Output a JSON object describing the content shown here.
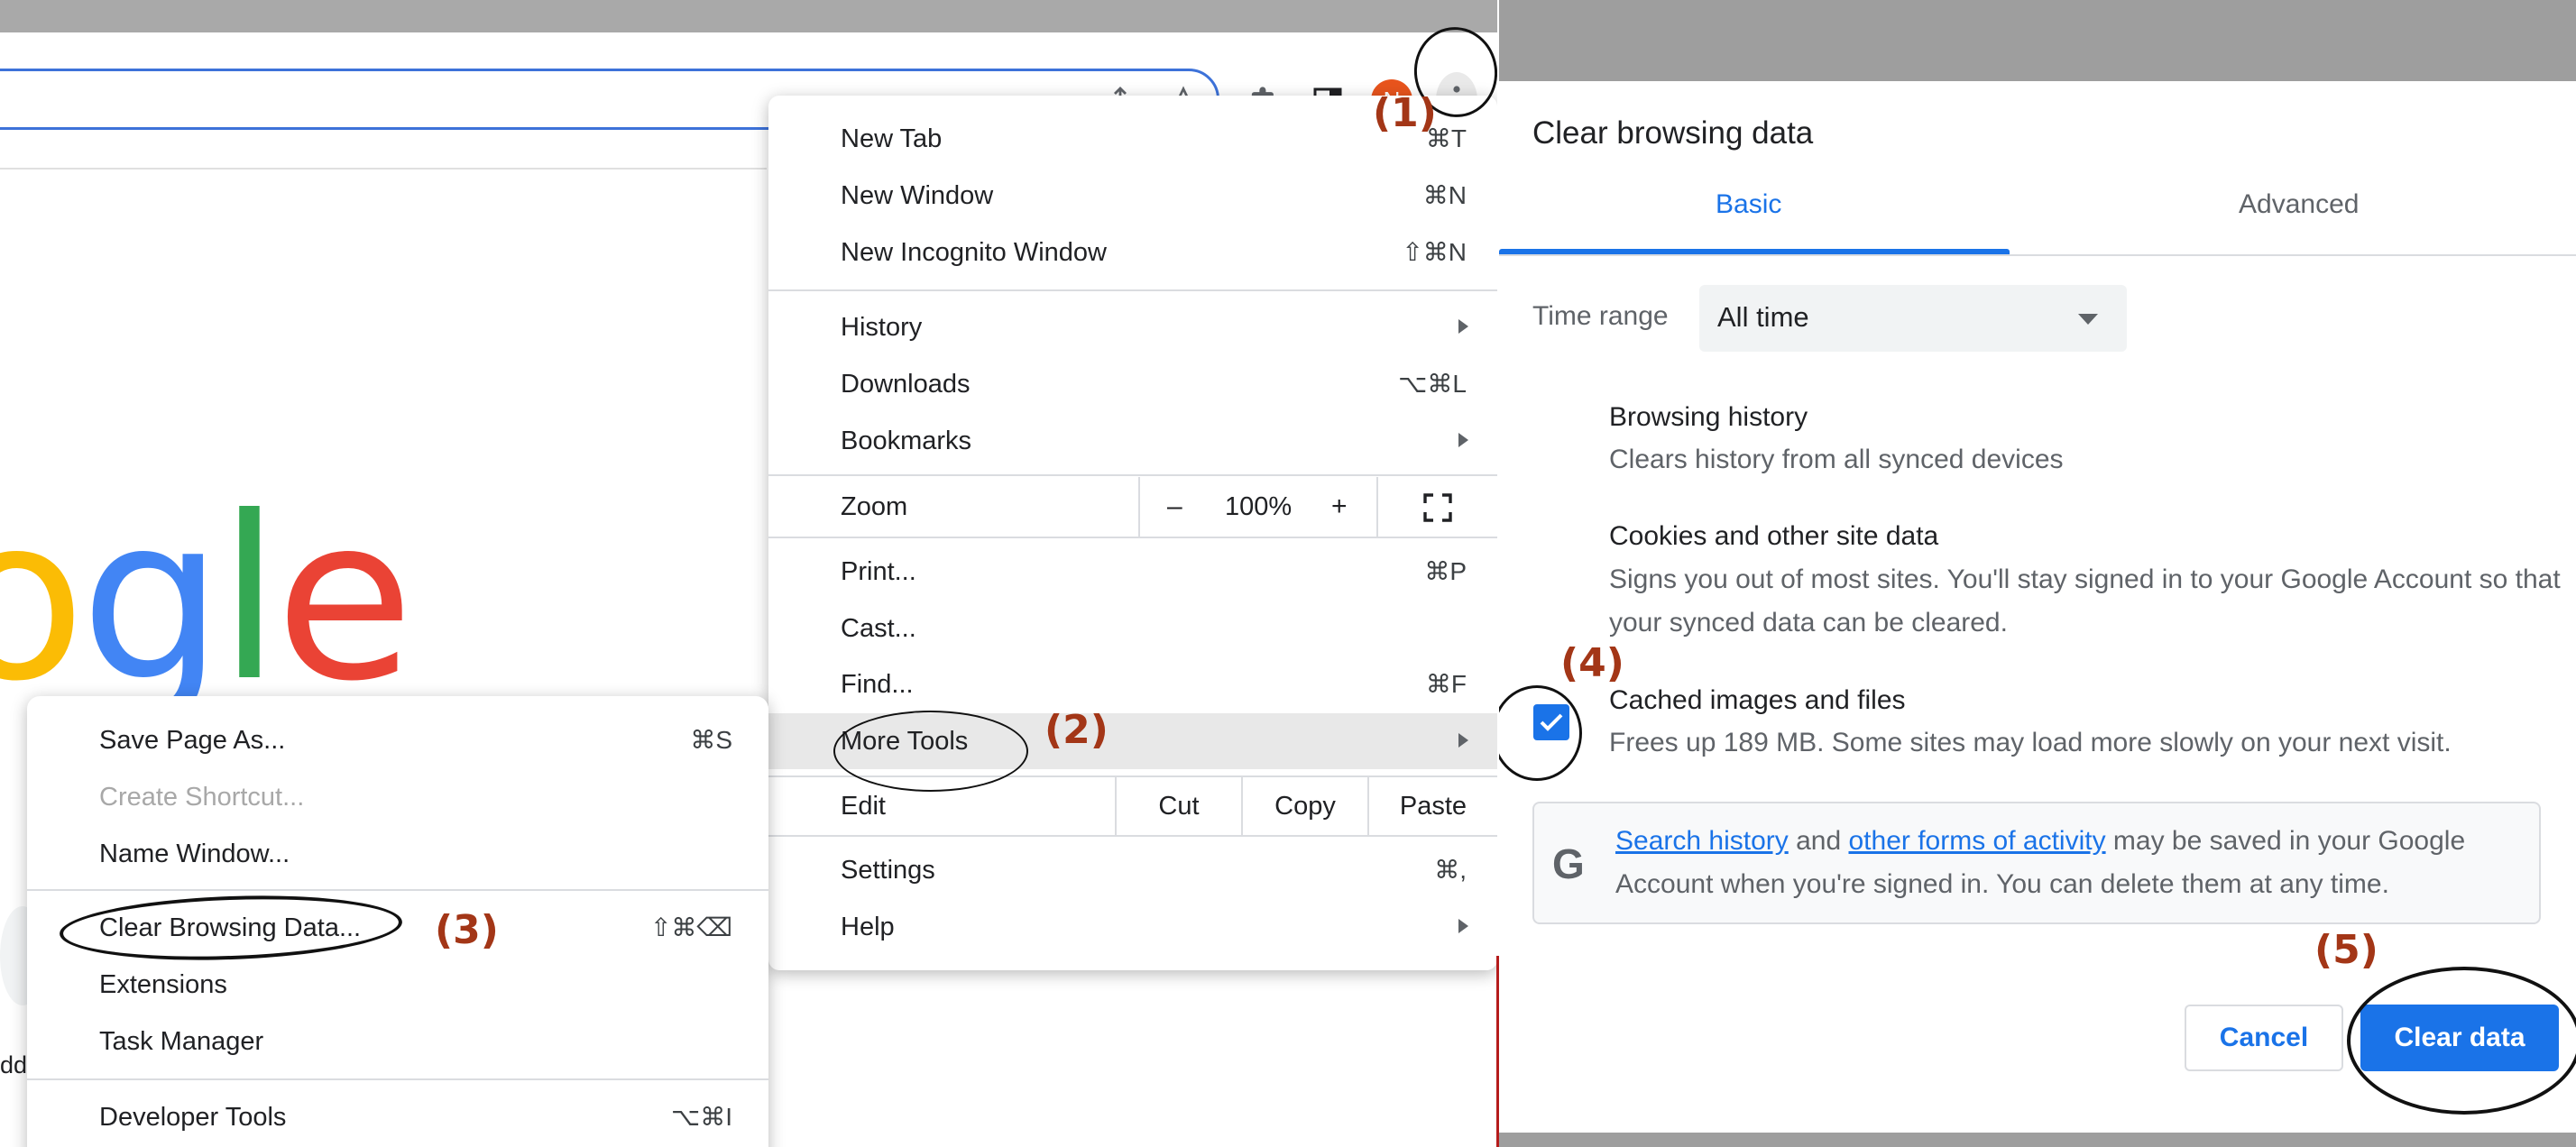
{
  "colors": {
    "accent": "#1a73e8",
    "annotation": "#a33617",
    "avatar": "#e8541d"
  },
  "toolbar": {
    "avatar_letter": "N",
    "icons": [
      "share-icon",
      "star-icon",
      "extensions-icon",
      "side-panel-icon",
      "kebab-menu-icon"
    ]
  },
  "page": {
    "logo_letters": [
      "o",
      "g",
      "l",
      "e"
    ],
    "partial_text": "dd"
  },
  "chrome_menu": {
    "new_tab": {
      "label": "New Tab",
      "shortcut": "⌘T"
    },
    "new_window": {
      "label": "New Window",
      "shortcut": "⌘N"
    },
    "new_incognito": {
      "label": "New Incognito Window",
      "shortcut": "⇧⌘N"
    },
    "history": {
      "label": "History"
    },
    "downloads": {
      "label": "Downloads",
      "shortcut": "⌥⌘L"
    },
    "bookmarks": {
      "label": "Bookmarks"
    },
    "zoom": {
      "label": "Zoom",
      "minus": "–",
      "level": "100%",
      "plus": "+"
    },
    "print": {
      "label": "Print...",
      "shortcut": "⌘P"
    },
    "cast": {
      "label": "Cast..."
    },
    "find": {
      "label": "Find...",
      "shortcut": "⌘F"
    },
    "more_tools": {
      "label": "More Tools"
    },
    "edit": {
      "label": "Edit",
      "cut": "Cut",
      "copy": "Copy",
      "paste": "Paste"
    },
    "settings": {
      "label": "Settings",
      "shortcut": "⌘,"
    },
    "help": {
      "label": "Help"
    }
  },
  "sub_menu": {
    "save_page": {
      "label": "Save Page As...",
      "shortcut": "⌘S"
    },
    "create_shortcut": {
      "label": "Create Shortcut..."
    },
    "name_window": {
      "label": "Name Window..."
    },
    "clear_browsing": {
      "label": "Clear Browsing Data...",
      "shortcut": "⇧⌘⌫"
    },
    "extensions": {
      "label": "Extensions"
    },
    "task_manager": {
      "label": "Task Manager"
    },
    "developer_tools": {
      "label": "Developer Tools",
      "shortcut": "⌥⌘I"
    }
  },
  "annotations": {
    "step1": "(1)",
    "step2": "(2)",
    "step3": "(3)",
    "step4": "(4)",
    "step5": "(5)"
  },
  "dialog": {
    "title": "Clear browsing data",
    "tabs": {
      "basic": "Basic",
      "advanced": "Advanced"
    },
    "time_range": {
      "label": "Time range",
      "value": "All time"
    },
    "options": {
      "browsing_history": {
        "title": "Browsing history",
        "desc": "Clears history from all synced devices"
      },
      "cookies": {
        "title": "Cookies and other site data",
        "desc": "Signs you out of most sites. You'll stay signed in to your Google Account so that your synced data can be cleared."
      },
      "cached": {
        "title": "Cached images and files",
        "desc": "Frees up 189 MB. Some sites may load more slowly on your next visit."
      }
    },
    "info": {
      "g_letter": "G",
      "link1": "Search history",
      "and": " and ",
      "link2": "other forms of activity",
      "rest": " may be saved in your Google Account when you're signed in. You can delete them at any time."
    },
    "buttons": {
      "cancel": "Cancel",
      "clear": "Clear data"
    }
  }
}
